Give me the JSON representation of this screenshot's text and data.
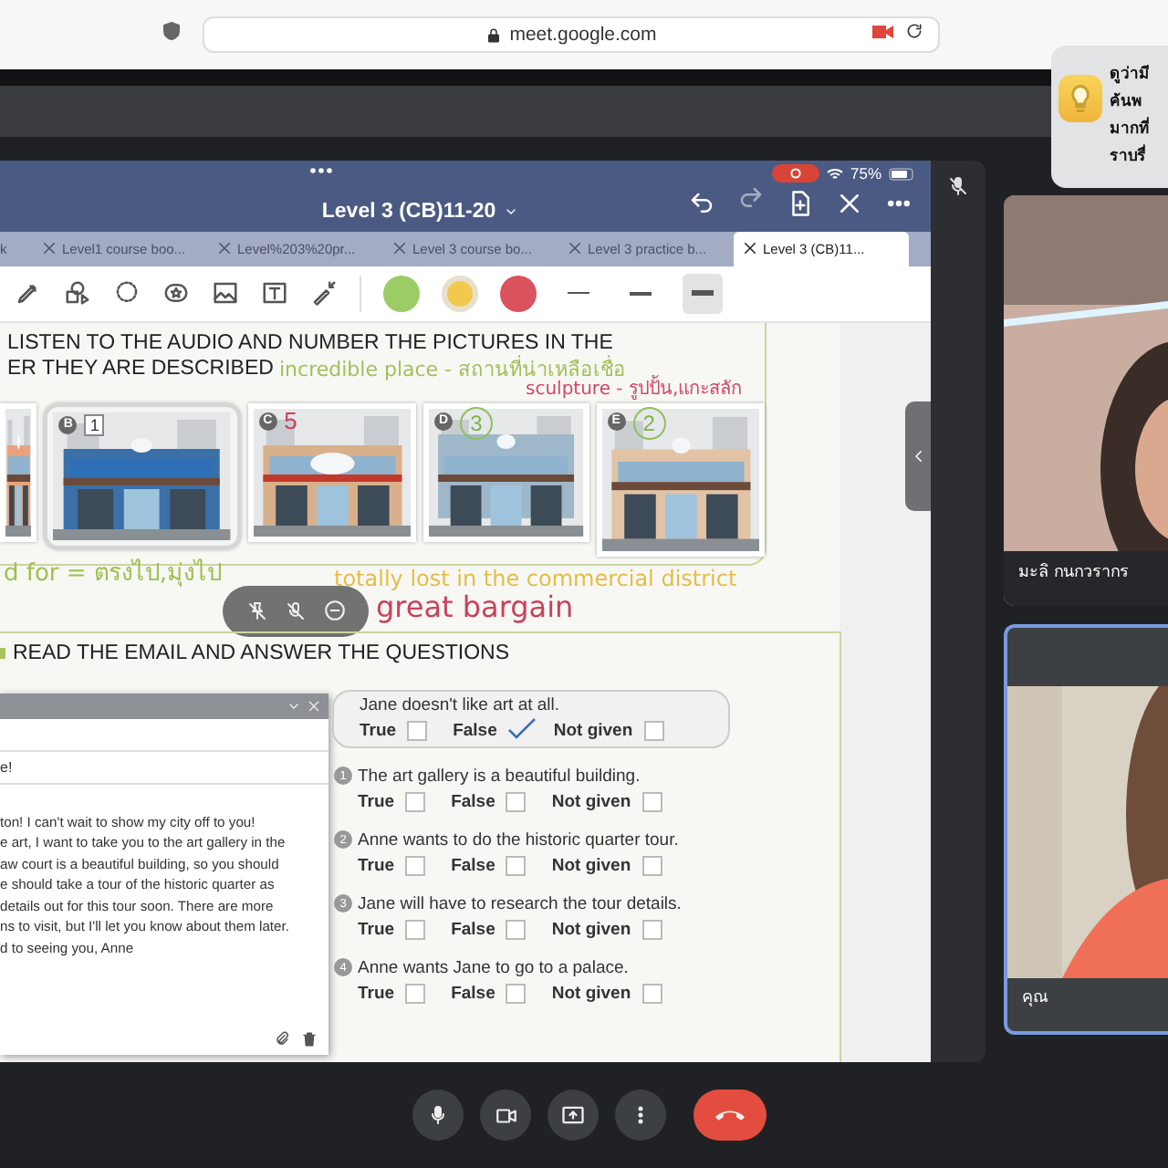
{
  "browser": {
    "url": "meet.google.com"
  },
  "notification": {
    "lines": [
      "ดูว่ามี",
      "ค้นพ",
      "มากที่",
      "ราบรื่"
    ]
  },
  "shared_screen": {
    "battery": "75%",
    "title": "Level 3 (CB)11-20",
    "tabs": [
      {
        "label": "k",
        "selected": false
      },
      {
        "label": "Level1 course boo...",
        "selected": false
      },
      {
        "label": "Level%203%20pr...",
        "selected": false
      },
      {
        "label": "Level 3 course bo...",
        "selected": false
      },
      {
        "label": "Level 3 practice b...",
        "selected": false
      },
      {
        "label": "Level 3 (CB)11...",
        "selected": true
      }
    ],
    "pen_colors": [
      {
        "color": "#9ccc65",
        "selected": false
      },
      {
        "color": "#f2c94c",
        "selected": true
      },
      {
        "color": "#d9525e",
        "selected": false
      }
    ],
    "line_widths": [
      {
        "selected": false
      },
      {
        "selected": false
      },
      {
        "selected": true
      }
    ],
    "page": {
      "section_1": {
        "heading_lines": [
          "LISTEN TO THE AUDIO AND NUMBER THE PICTURES IN THE",
          "ER THEY ARE DESCRIBED"
        ],
        "pictures": [
          {
            "selected": false
          },
          {
            "letter": "B",
            "answer": "1",
            "selected": true
          },
          {
            "letter": "C",
            "answer": "5",
            "selected": false
          },
          {
            "letter": "D",
            "answer": "3",
            "selected": false
          },
          {
            "letter": "E",
            "answer": "2",
            "selected": false
          }
        ]
      },
      "notes": [
        {
          "text": "incredible place - สถานที่น่าเหลือเชื่อ",
          "color": "#a3bf5a"
        },
        {
          "text": "sculpture - รูปปั้น,แกะสลัก",
          "color": "#d04a68"
        },
        {
          "text": "d for = ตรงไป,มุ่งไป",
          "color": "#9fbf4f"
        },
        {
          "text": "totally lost in the commercial district",
          "color": "#e3bd45"
        },
        {
          "text": "great bargain",
          "color": "#c7435a"
        }
      ],
      "section_2": {
        "heading": "READ THE EMAIL AND ANSWER THE QUESTIONS",
        "email": {
          "subject": "e!",
          "body_lines": [
            "ton! I can't wait to show my city off to you!",
            "e art, I want to take you to the art gallery in the",
            "aw court is a beautiful building, so you should",
            "e should take a tour of the historic quarter as",
            "details out for this tour soon. There are more",
            "ns to visit, but I'll let you know about them later.",
            "d to seeing you, Anne"
          ]
        },
        "questions": [
          {
            "kind": "example",
            "text": "Jane doesn't like art at all.",
            "options": [
              {
                "label": "True",
                "checked": false
              },
              {
                "label": "False",
                "checked": true
              },
              {
                "label": "Not given",
                "checked": false
              }
            ]
          },
          {
            "kind": "numbered",
            "number": "1",
            "text": "The art gallery is a beautiful building.",
            "options": [
              {
                "label": "True",
                "checked": false
              },
              {
                "label": "False",
                "checked": false
              },
              {
                "label": "Not given",
                "checked": false
              }
            ]
          },
          {
            "kind": "numbered",
            "number": "2",
            "text": "Anne wants to do the historic quarter tour.",
            "options": [
              {
                "label": "True",
                "checked": false
              },
              {
                "label": "False",
                "checked": false
              },
              {
                "label": "Not given",
                "checked": false
              }
            ]
          },
          {
            "kind": "numbered",
            "number": "3",
            "text": "Jane will have to research the tour details.",
            "options": [
              {
                "label": "True",
                "checked": false
              },
              {
                "label": "False",
                "checked": false
              },
              {
                "label": "Not given",
                "checked": false
              }
            ]
          },
          {
            "kind": "numbered",
            "number": "4",
            "text": "Anne wants Jane to go to a palace.",
            "options": [
              {
                "label": "True",
                "checked": false
              },
              {
                "label": "False",
                "checked": false
              },
              {
                "label": "Not given",
                "checked": false
              }
            ]
          }
        ]
      }
    }
  },
  "participants": [
    {
      "name": "มะลิ กนกวรากร",
      "selected": false
    },
    {
      "name": "คุณ",
      "selected": true
    }
  ],
  "call_controls": [
    {
      "kind": "mic"
    },
    {
      "kind": "camera"
    },
    {
      "kind": "present"
    },
    {
      "kind": "more"
    },
    {
      "kind": "end"
    }
  ]
}
